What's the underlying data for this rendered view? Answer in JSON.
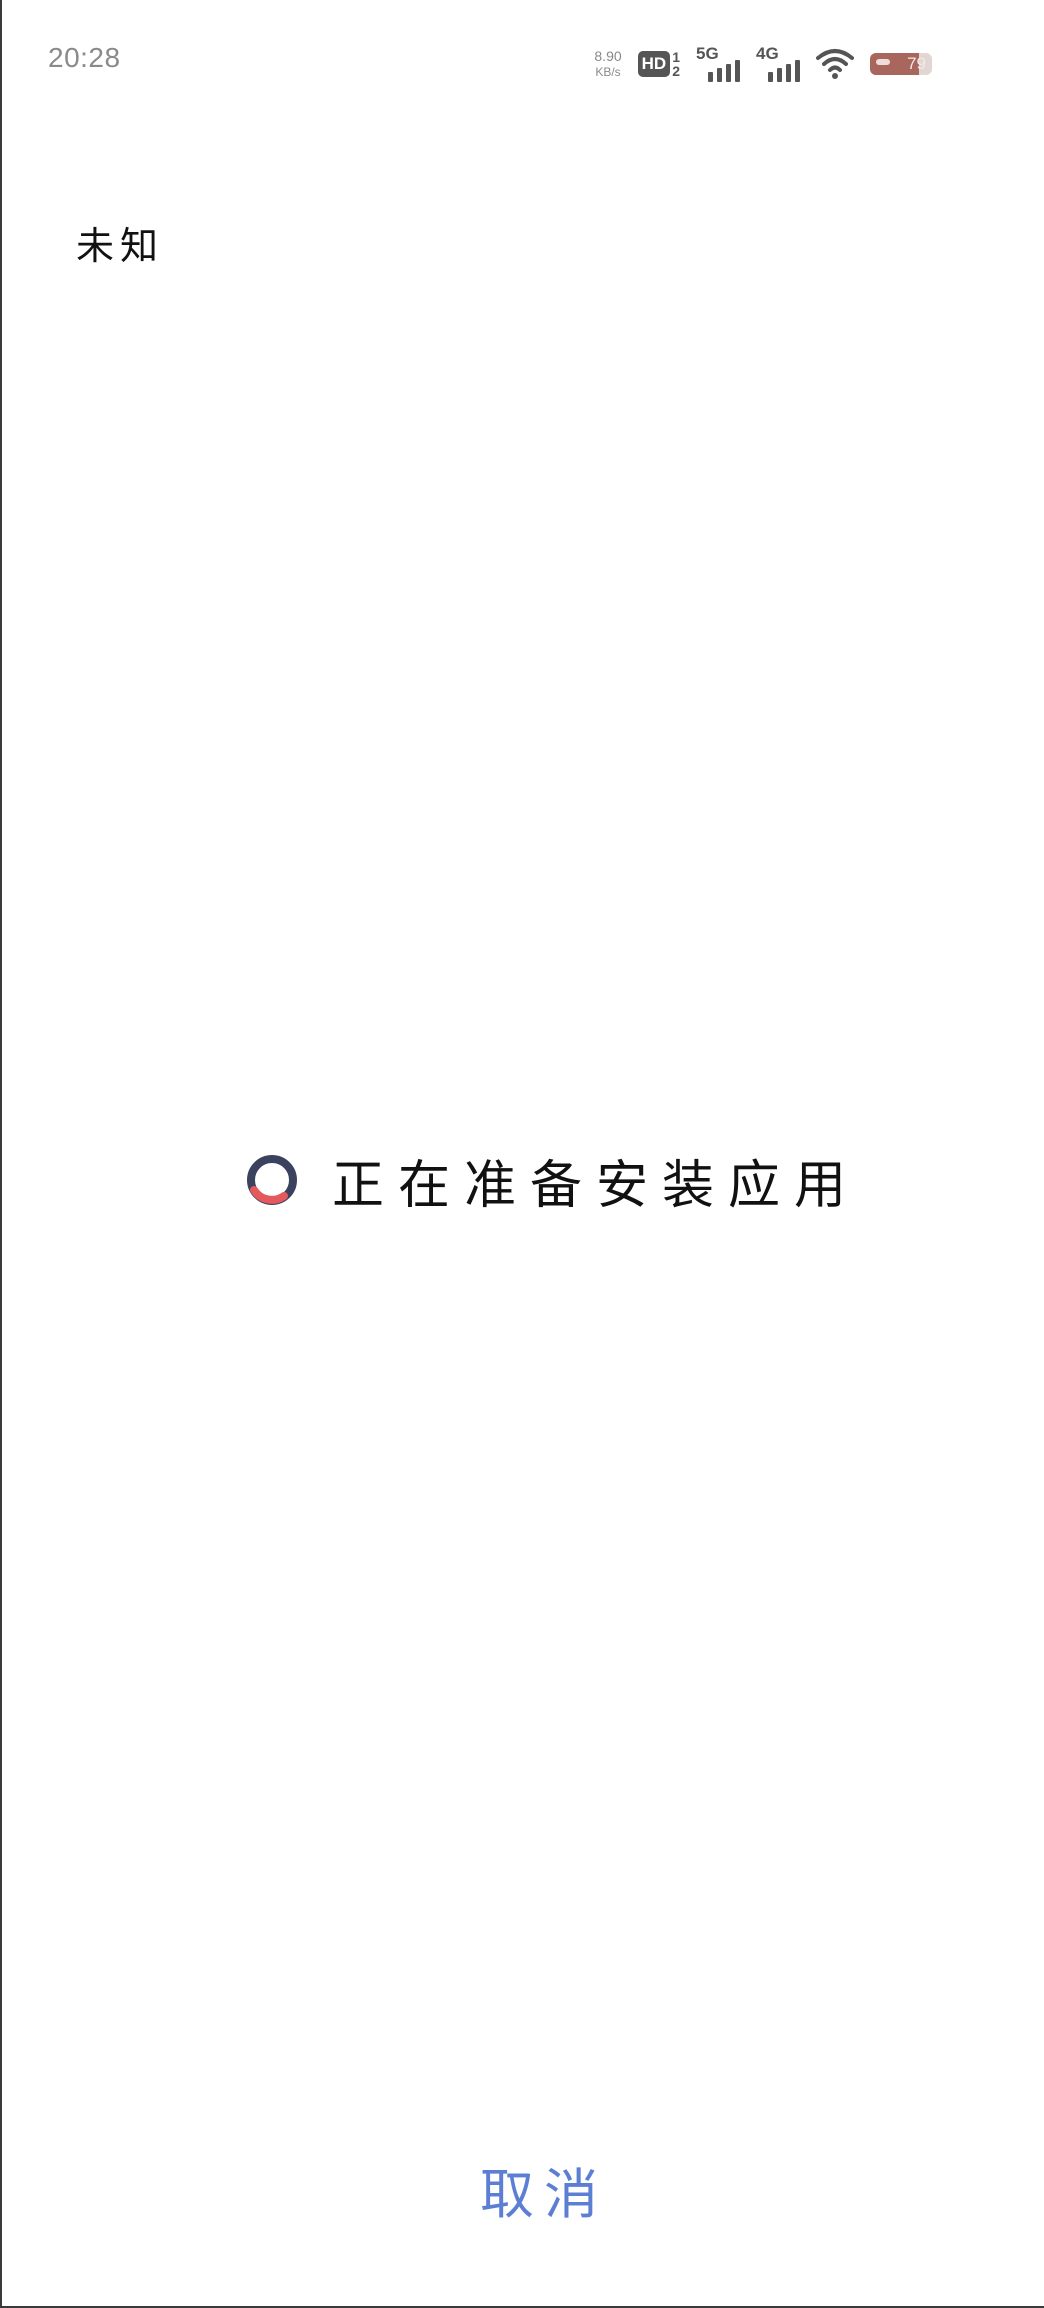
{
  "status_bar": {
    "time": "20:28",
    "net_speed_value": "8.90",
    "net_speed_unit": "KB/s",
    "hd_label": "HD",
    "hd_sim_top": "1",
    "hd_sim_bottom": "2",
    "signal_1_label": "5G",
    "signal_2_label": "4G",
    "battery_level": "79",
    "battery_fraction": 0.79
  },
  "app": {
    "name": "未知"
  },
  "install": {
    "status_text": "正在准备安装应用",
    "cancel_label": "取消"
  },
  "colors": {
    "spinner_track": "#3b4260",
    "spinner_accent": "#e5585d",
    "cancel_text": "#5d7fd3",
    "battery_fill": "#a8665c"
  },
  "icons": {
    "spinner": "loading-spinner-icon",
    "wifi": "wifi-icon",
    "battery": "battery-icon"
  }
}
